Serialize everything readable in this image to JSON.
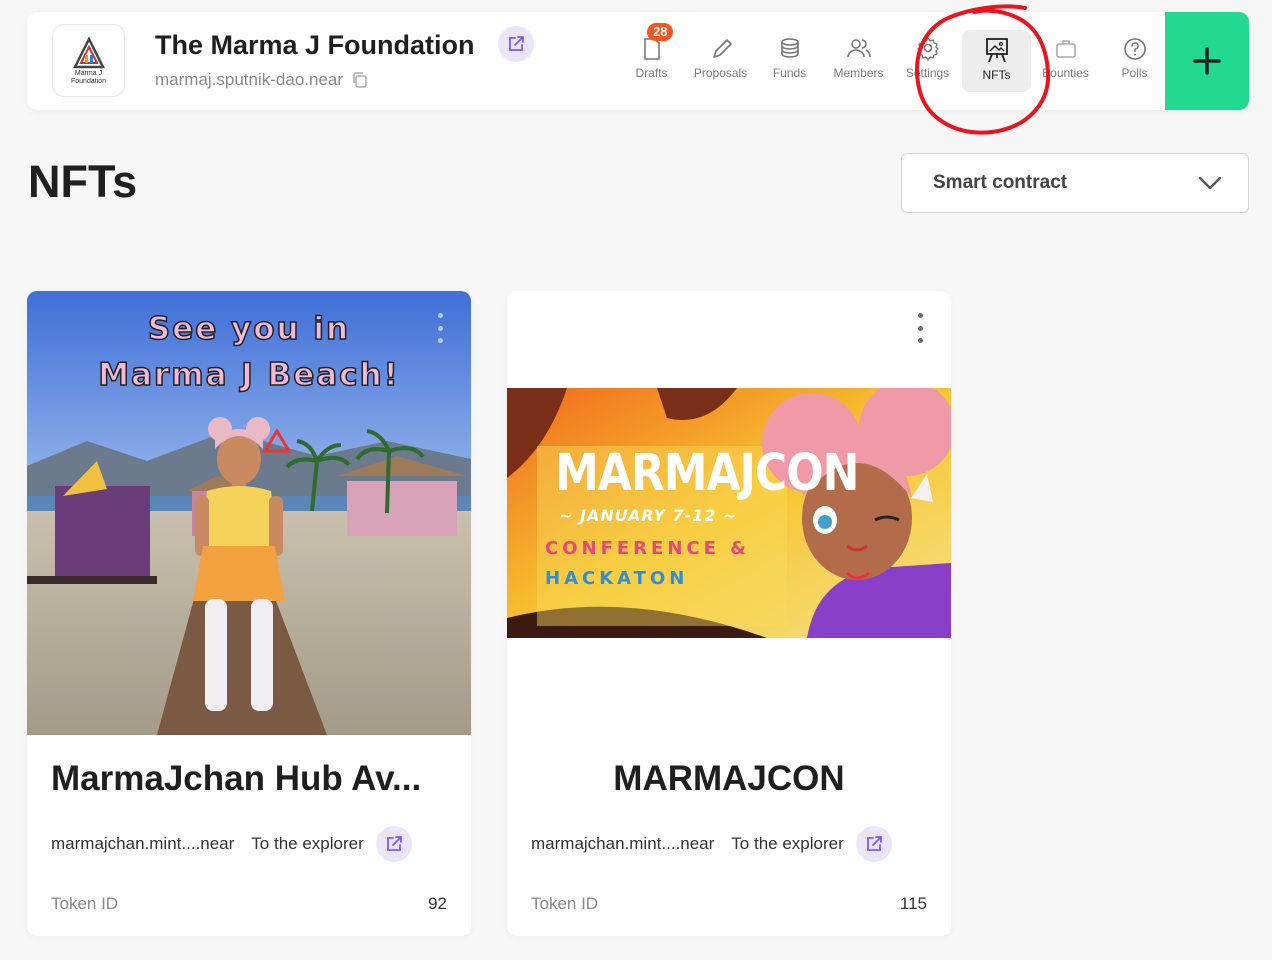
{
  "header": {
    "logo_text": "Marma J\nFoundation",
    "title": "The Marma J Foundation",
    "account": "marmaj.sputnik-dao.near",
    "nav": [
      {
        "label": "Drafts",
        "icon": "drafts-icon",
        "badge": "28"
      },
      {
        "label": "Proposals",
        "icon": "pencil-icon"
      },
      {
        "label": "Funds",
        "icon": "coins-icon"
      },
      {
        "label": "Members",
        "icon": "members-icon"
      },
      {
        "label": "Settings",
        "icon": "gear-icon"
      },
      {
        "label": "NFTs",
        "icon": "easel-icon",
        "active": true
      },
      {
        "label": "Bounties",
        "icon": "briefcase-icon"
      },
      {
        "label": "Polls",
        "icon": "question-circle-icon"
      }
    ],
    "create_label": "+"
  },
  "page": {
    "title": "NFTs",
    "filter_select": "Smart contract"
  },
  "nfts": [
    {
      "name": "MarmaJchan Hub Av...",
      "image_caption": [
        "See you in",
        "Marma J Beach!"
      ],
      "contract": "marmajchan.mint....near",
      "explorer_label": "To the explorer",
      "token_label": "Token ID",
      "token_id": "92"
    },
    {
      "name": "MARMAJCON",
      "image_title": "MARMAJCON",
      "image_dates": "~ JANUARY 7-12 ~",
      "image_line1": "CONFERENCE &",
      "image_line2": "HACKATON",
      "contract": "marmajchan.mint....near",
      "explorer_label": "To the explorer",
      "token_label": "Token ID",
      "token_id": "115"
    }
  ],
  "colors": {
    "accent_green": "#21d991",
    "badge_orange": "#f7571e",
    "link_purple_bg": "#ebe5fb",
    "link_purple_icon": "#7b5ce5",
    "annotation_red": "#e8141e"
  }
}
